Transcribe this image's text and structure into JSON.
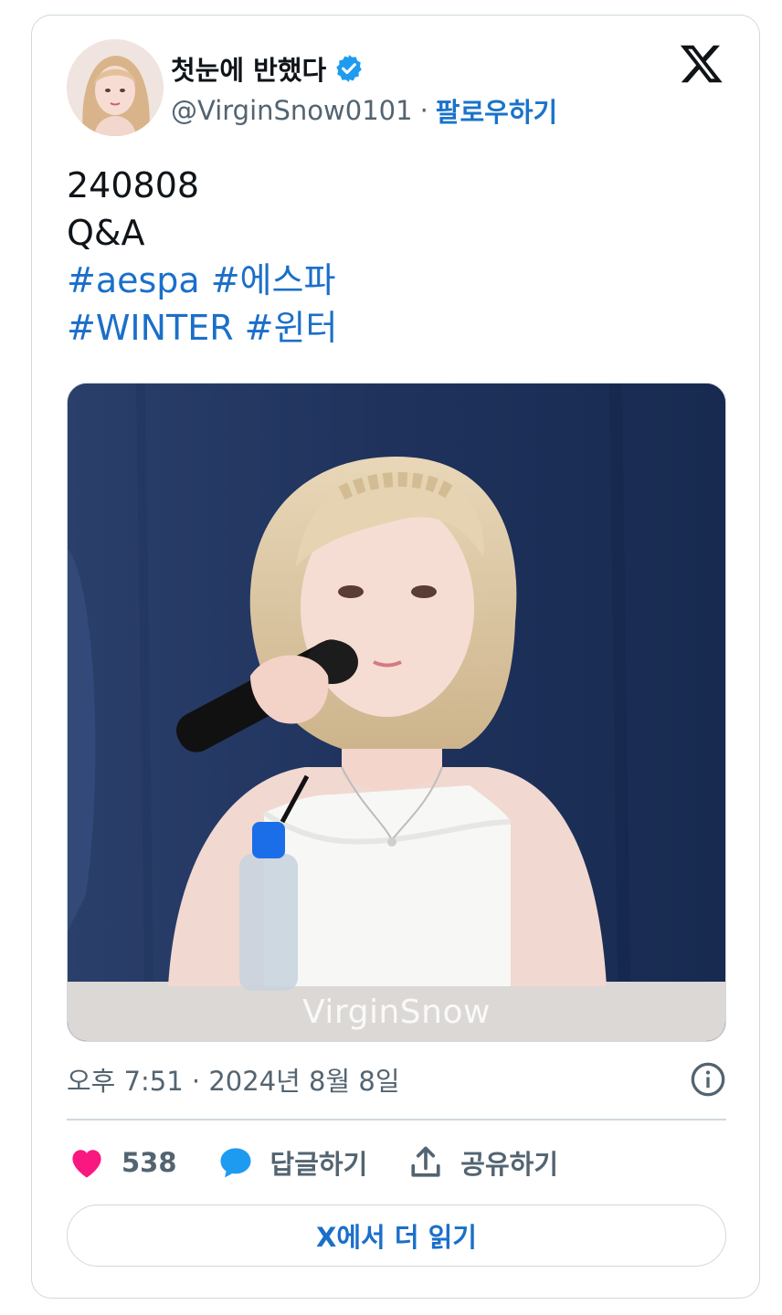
{
  "author": {
    "display_name": "첫눈에 반했다",
    "handle": "@VirginSnow0101",
    "separator": "·",
    "follow_label": "팔로우하기",
    "verified": true
  },
  "tweet": {
    "lines": [
      "240808",
      "Q&A"
    ],
    "hashtags_line1": [
      "#aespa",
      "#에스파"
    ],
    "hashtags_line2": [
      "#WINTER",
      "#윈터"
    ]
  },
  "media": {
    "watermark": "VirginSnow"
  },
  "meta": {
    "timestamp": "오후 7:51 · 2024년 8월 8일"
  },
  "actions": {
    "like_count": "538",
    "reply_label": "답글하기",
    "share_label": "공유하기"
  },
  "read_more_label": "X에서 더 읽기",
  "colors": {
    "link": "#1b6fc9",
    "verified": "#1d9bf0",
    "heart": "#f91880",
    "border": "#cfd9de",
    "muted": "#536471"
  },
  "icons": [
    "verified-badge-icon",
    "x-logo-icon",
    "info-icon",
    "heart-icon",
    "reply-bubble-icon",
    "share-icon"
  ]
}
